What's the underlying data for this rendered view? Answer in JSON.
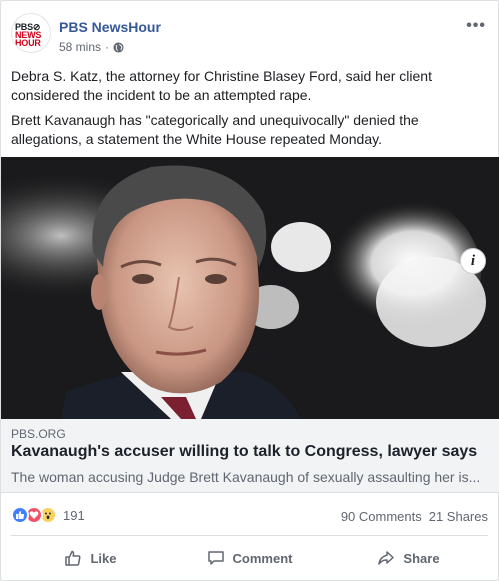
{
  "post": {
    "page_name": "PBS NewsHour",
    "logo_line1": "PBS⊘",
    "logo_line2": "NEWS",
    "logo_line3": "HOUR",
    "time": "58 mins",
    "dot": "·",
    "more": "•••",
    "paragraphs": [
      "Debra S. Katz, the attorney for Christine Blasey Ford, said her client considered the incident to be an attempted rape.",
      "Brett Kavanaugh has \"categorically and unequivocally\" denied the allegations, a statement the White House repeated Monday."
    ],
    "icons": {
      "privacy": "globe-icon",
      "info": "info-icon",
      "more": "more-options-icon"
    }
  },
  "link": {
    "domain": "PBS.ORG",
    "title": "Kavanaugh's accuser willing to talk to Congress, lawyer says",
    "description": "The woman accusing Judge Brett Kavanaugh of sexually assaulting her is...",
    "info_glyph": "i"
  },
  "stats": {
    "reaction_count": "191",
    "comments": "90 Comments",
    "shares": "21 Shares",
    "reaction_icons": [
      "like-reaction-icon",
      "love-reaction-icon",
      "wow-reaction-icon"
    ]
  },
  "actions": {
    "like": "Like",
    "comment": "Comment",
    "share": "Share"
  },
  "colors": {
    "brand": "#365899",
    "pbs_red": "#d0021b",
    "like_blue": "#4080ff",
    "love_red": "#f25268",
    "wow_yellow": "#fcd15b"
  }
}
